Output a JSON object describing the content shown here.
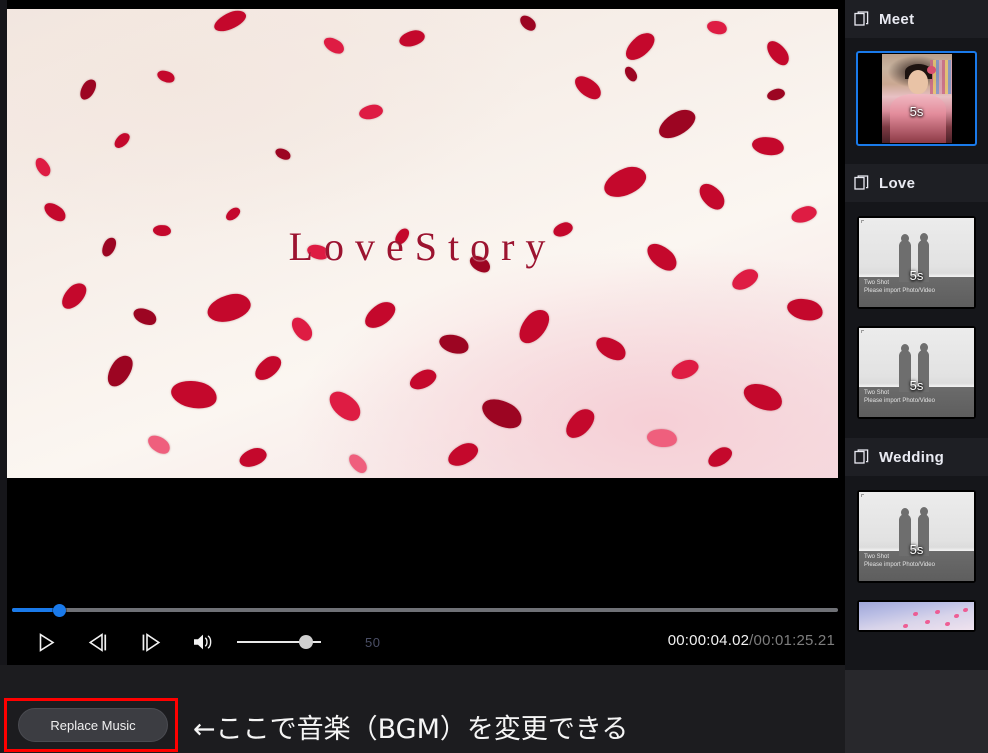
{
  "app": {
    "background_color": "#1c1c1f",
    "accent_color": "#1a7aea",
    "highlight_color": "#ff0000"
  },
  "player": {
    "video_title_overlay": "LoveStory",
    "seek": {
      "position_percent": 5,
      "playhead_label": "playhead"
    },
    "controls": [
      {
        "name": "play-button",
        "icon": "play-icon",
        "label": "Play"
      },
      {
        "name": "previous-frame-button",
        "icon": "previous-frame-icon",
        "label": "Previous Frame"
      },
      {
        "name": "next-frame-button",
        "icon": "next-frame-icon",
        "label": "Next Frame"
      },
      {
        "name": "volume-button",
        "icon": "volume-icon",
        "label": "Volume"
      }
    ],
    "volume": {
      "value": "50",
      "percent": 74
    },
    "timecode": {
      "current": "00:00:04.02",
      "separator": "/",
      "total": "00:01:25.21"
    }
  },
  "bottom_bar": {
    "replace_music_label": "Replace Music",
    "annotation_text": "←ここで音楽（BGM）を変更できる"
  },
  "sidebar": {
    "sections": [
      {
        "label": "Meet",
        "icon": "layers-icon",
        "clips": [
          {
            "kind": "photo",
            "duration": "5s",
            "selected": true,
            "caption": ""
          }
        ]
      },
      {
        "label": "Love",
        "icon": "layers-icon",
        "clips": [
          {
            "kind": "twoshot",
            "duration": "5s",
            "selected": false,
            "caption_line1": "Two Shot",
            "caption_line2": "Please import Photo/Video"
          },
          {
            "kind": "twoshot",
            "duration": "5s",
            "selected": false,
            "caption_line1": "Two Shot",
            "caption_line2": "Please import Photo/Video"
          }
        ]
      },
      {
        "label": "Wedding",
        "icon": "layers-icon",
        "clips": [
          {
            "kind": "twoshot",
            "duration": "5s",
            "selected": false,
            "caption_line1": "Two Shot",
            "caption_line2": "Please import Photo/Video"
          },
          {
            "kind": "petals",
            "duration": "",
            "selected": false,
            "clipped": true,
            "caption": ""
          }
        ]
      }
    ]
  }
}
